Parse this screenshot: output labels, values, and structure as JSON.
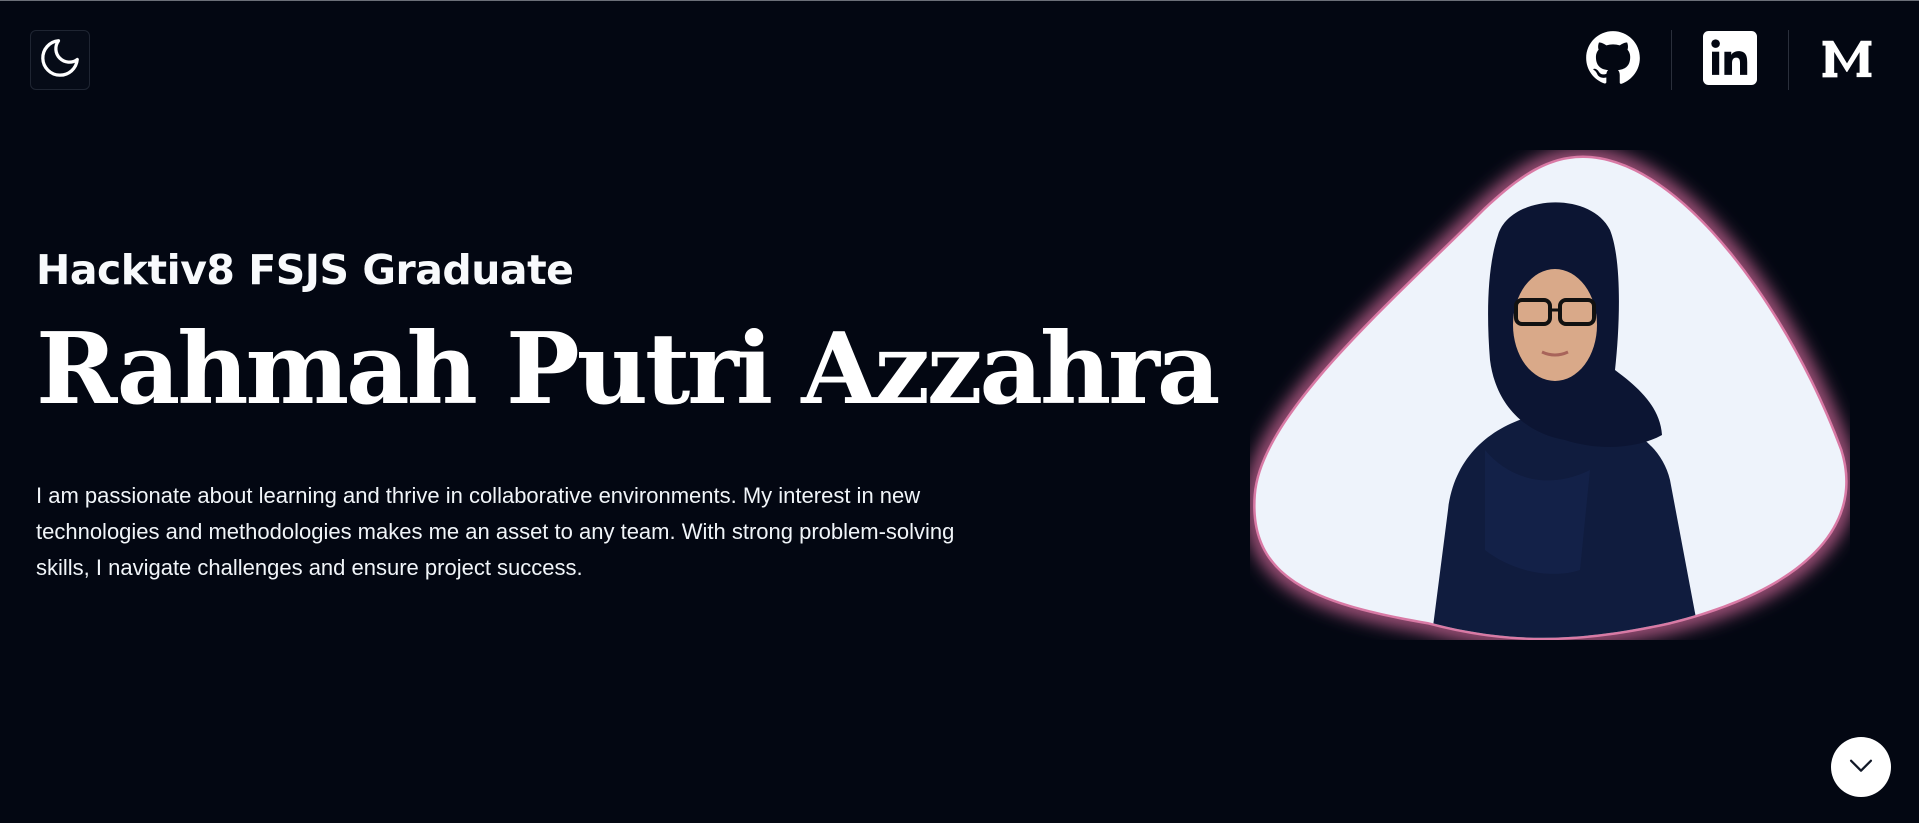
{
  "header": {
    "theme_toggle_icon": "moon-icon",
    "social_links": [
      {
        "name": "GitHub",
        "icon": "github-icon"
      },
      {
        "name": "LinkedIn",
        "icon": "linkedin-icon"
      },
      {
        "name": "Medium",
        "icon": "medium-icon"
      }
    ]
  },
  "hero": {
    "subtitle": "Hacktiv8 FSJS Graduate",
    "name": "Rahmah Putri Azzahra",
    "bio": "I am passionate about learning and thrive in collaborative environments. My interest in new technologies and methodologies makes me an asset to any team. With strong problem-solving skills, I navigate challenges and ensure project success.",
    "portrait_icon": "profile-photo"
  },
  "scroll_button_icon": "chevron-down-icon",
  "colors": {
    "background": "#030712",
    "text": "#f8fafc",
    "portrait_glow": "#c0608e",
    "portrait_bg": "#eef3fb"
  }
}
